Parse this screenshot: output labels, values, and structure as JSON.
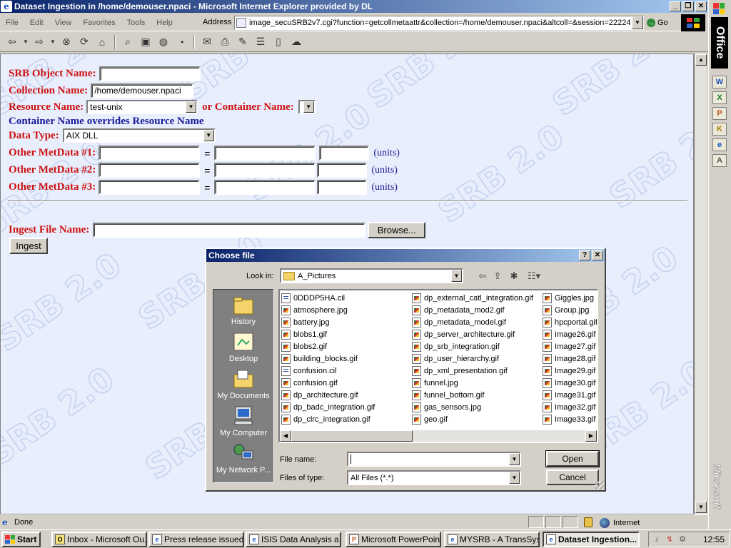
{
  "window": {
    "title": "Dataset Ingestion in /home/demouser.npaci - Microsoft Internet Explorer provided by DL"
  },
  "menu": [
    "File",
    "Edit",
    "View",
    "Favorites",
    "Tools",
    "Help"
  ],
  "address": {
    "label": "Address",
    "url": "image_secuSRB2v7.cgi?function=getcollmetaattr&collection=/home/demouser.npaci&altcoll=&session=22224",
    "go_label": "Go"
  },
  "watermark": "SRB 2.0",
  "form": {
    "object_name_label": "SRB Object Name:",
    "object_name_value": "",
    "collection_label": "Collection Name:",
    "collection_value": "/home/demouser.npaci",
    "resource_label": "Resource Name:",
    "resource_value": "test-unix",
    "container_label": "or Container Name:",
    "container_value": "",
    "override_note": "Container Name overrides Resource Name",
    "datatype_label": "Data Type:",
    "datatype_value": "AIX DLL",
    "metadata_rows": [
      {
        "label": "Other MetData #1:",
        "name": "",
        "value": "",
        "units": "",
        "units_label": "(units)"
      },
      {
        "label": "Other MetData #2:",
        "name": "",
        "value": "",
        "units": "",
        "units_label": "(units)"
      },
      {
        "label": "Other MetData #3:",
        "name": "",
        "value": "",
        "units": "",
        "units_label": "(units)"
      }
    ],
    "equals": "=",
    "ingest_label": "Ingest File Name:",
    "ingest_value": "",
    "browse_label": "Browse...",
    "ingest_button": "Ingest"
  },
  "status": {
    "text": "Done",
    "zone": "Internet"
  },
  "office_bar": {
    "title": "Office",
    "brand": "Microsoft",
    "buttons": [
      "W",
      "X",
      "P",
      "K",
      "e",
      "A"
    ]
  },
  "taskbar": {
    "start_label": "Start",
    "tasks": [
      {
        "label": "Inbox - Microsoft Ou..."
      },
      {
        "label": "Press release issued..."
      },
      {
        "label": "ISIS Data Analysis a..."
      },
      {
        "label": "Microsoft PowerPoin..."
      },
      {
        "label": "MYSRB - A TransSys..."
      },
      {
        "label": "Dataset Ingestion..."
      }
    ],
    "clock": "12:55"
  },
  "dialog": {
    "title": "Choose file",
    "look_in_label": "Look in:",
    "look_in_value": "A_Pictures",
    "places": [
      "History",
      "Desktop",
      "My Documents",
      "My Computer",
      "My Network P..."
    ],
    "files": [
      [
        "0DDDP5HA.cil",
        "atmosphere.jpg",
        "battery.jpg",
        "blobs1.gif",
        "blobs2.gif",
        "building_blocks.gif",
        "confusion.cil",
        "confusion.gif",
        "dp_architecture.gif",
        "dp_badc_integration.gif",
        "dp_clrc_integration.gif"
      ],
      [
        "dp_external_catl_integration.gif",
        "dp_metadata_mod2.gif",
        "dp_metadata_model.gif",
        "dp_server_architecture.gif",
        "dp_srb_integration.gif",
        "dp_user_hierarchy.gif",
        "dp_xml_presentation.gif",
        "funnel.jpg",
        "funnel_bottom.gif",
        "gas_sensors.jpg",
        "geo.gif"
      ],
      [
        "Giggles.jpg",
        "Group.jpg",
        "hpcportal.gif",
        "Image26.gif",
        "Image27.gif",
        "Image28.gif",
        "Image29.gif",
        "Image30.gif",
        "Image31.gif",
        "Image32.gif",
        "Image33.gif"
      ]
    ],
    "file_name_label": "File name:",
    "file_name_value": "",
    "file_type_label": "Files of type:",
    "file_type_value": "All Files (*.*)",
    "open_label": "Open",
    "cancel_label": "Cancel"
  }
}
